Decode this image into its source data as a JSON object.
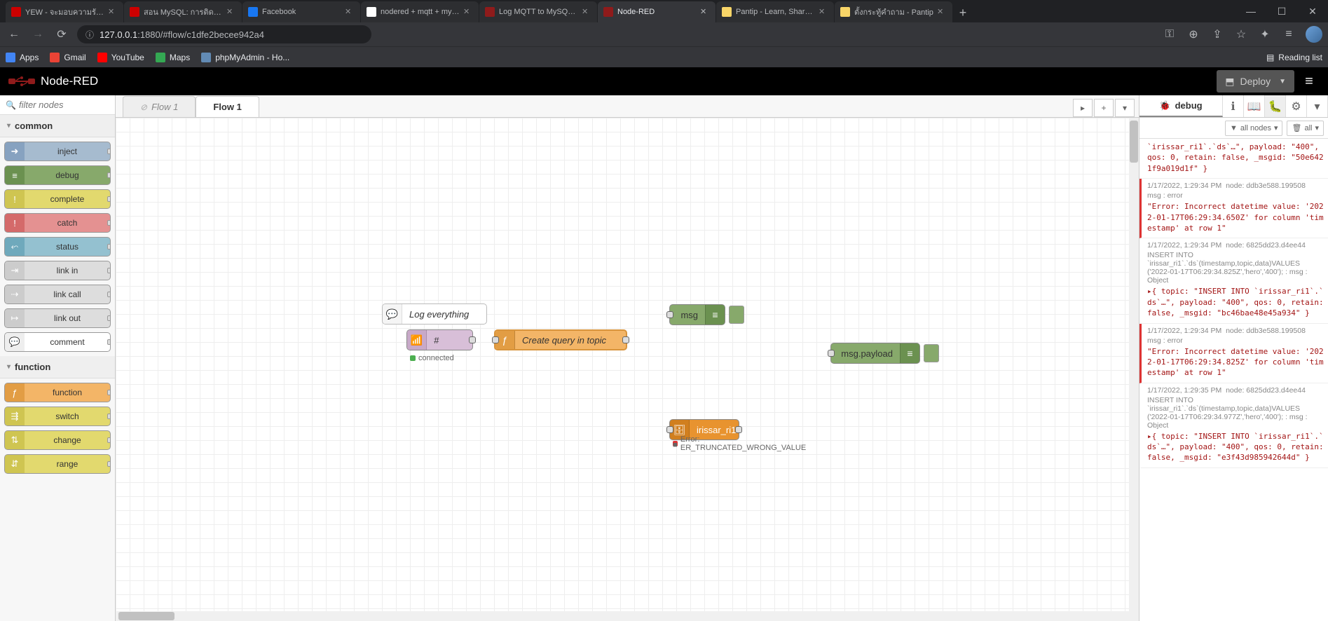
{
  "browser": {
    "tabs": [
      {
        "title": "YEW - จะมอบความรัก | Wish",
        "favicon": "#cc0000"
      },
      {
        "title": "สอน MySQL: การติดตั้ง MySQ",
        "favicon": "#cc0000"
      },
      {
        "title": "Facebook",
        "favicon": "#1877f2"
      },
      {
        "title": "nodered + mqtt + mysql -",
        "favicon": "#ffffff"
      },
      {
        "title": "Log MQTT to MySQL (flow",
        "favicon": "#8f1b1b"
      },
      {
        "title": "Node-RED",
        "favicon": "#8f1b1b",
        "active": true
      },
      {
        "title": "Pantip - Learn, Share & Fu",
        "favicon": "#f8d568"
      },
      {
        "title": "ตั้งกระทู้คำถาม - Pantip",
        "favicon": "#f8d568"
      }
    ],
    "url_host": "127.0.0.1",
    "url_port_path": ":1880/#flow/c1dfe2becee942a4",
    "bookmarks": [
      {
        "label": "Apps",
        "color": "#4285f4"
      },
      {
        "label": "Gmail",
        "color": "#ea4335"
      },
      {
        "label": "YouTube",
        "color": "#ff0000"
      },
      {
        "label": "Maps",
        "color": "#34a853"
      },
      {
        "label": "phpMyAdmin - Ho...",
        "color": "#628bb5"
      }
    ],
    "reading_list": "Reading list"
  },
  "nodered": {
    "brand": "Node-RED",
    "deploy": "Deploy",
    "palette_filter_placeholder": "filter nodes",
    "categories": [
      {
        "name": "common",
        "nodes": [
          {
            "label": "inject",
            "bg": "#a6bbcf",
            "icon_bg": "#87a2c0",
            "icon": "➜"
          },
          {
            "label": "debug",
            "bg": "#87a96b",
            "icon_bg": "#6b9150",
            "icon": "≡"
          },
          {
            "label": "complete",
            "bg": "#e2d96e",
            "icon_bg": "#cfc551",
            "icon": "!"
          },
          {
            "label": "catch",
            "bg": "#e49191",
            "icon_bg": "#d46a6a",
            "icon": "!"
          },
          {
            "label": "status",
            "bg": "#94c1d0",
            "icon_bg": "#6fa9bc",
            "icon": "⬿"
          },
          {
            "label": "link in",
            "bg": "#ddd",
            "icon_bg": "#ccc",
            "icon": "⇥"
          },
          {
            "label": "link call",
            "bg": "#ddd",
            "icon_bg": "#ccc",
            "icon": "⇢"
          },
          {
            "label": "link out",
            "bg": "#ddd",
            "icon_bg": "#ccc",
            "icon": "↦"
          },
          {
            "label": "comment",
            "bg": "#fff",
            "icon_bg": "#eee",
            "icon": "💬"
          }
        ]
      },
      {
        "name": "function",
        "nodes": [
          {
            "label": "function",
            "bg": "#f3b567",
            "icon_bg": "#e29d44",
            "icon": "ƒ"
          },
          {
            "label": "switch",
            "bg": "#e2d96e",
            "icon_bg": "#cfc551",
            "icon": "⇶"
          },
          {
            "label": "change",
            "bg": "#e2d96e",
            "icon_bg": "#cfc551",
            "icon": "⇅"
          },
          {
            "label": "range",
            "bg": "#e2d96e",
            "icon_bg": "#cfc551",
            "icon": "⇵"
          }
        ]
      }
    ],
    "workspace_tabs": [
      {
        "label": "Flow 1",
        "disabled": true
      },
      {
        "label": "Flow 1",
        "active": true
      }
    ],
    "flow_nodes": {
      "comment": {
        "label": "Log everything"
      },
      "mqtt": {
        "label": "#",
        "status": "connected"
      },
      "func": {
        "label": "Create query in topic"
      },
      "debug1": {
        "label": "msg"
      },
      "debug2": {
        "label": "msg.payload"
      },
      "mysql": {
        "label": "irissar_ri1",
        "error": "Error: ER_TRUNCATED_WRONG_VALUE"
      }
    },
    "sidebar": {
      "tab_label": "debug",
      "filter_all_nodes": "all nodes",
      "filter_all": "all"
    },
    "debug": [
      {
        "type": "obj",
        "text": "`irissar_ri1`.`ds`…\", payload: \"400\", qos: 0, retain: false, _msgid: \"50e6421f9a019d1f\" }"
      },
      {
        "type": "err",
        "ts": "1/17/2022, 1:29:34 PM",
        "node": "node: ddb3e588.199508",
        "topic": "msg : error",
        "text": "\"Error: Incorrect datetime value: '2022-01-17T06:29:34.650Z' for column 'timestamp' at row 1\""
      },
      {
        "type": "info",
        "ts": "1/17/2022, 1:29:34 PM",
        "node": "node: 6825dd23.d4ee44",
        "topic": "INSERT INTO `irissar_ri1`.`ds`(timestamp,topic,data)VALUES ('2022-01-17T06:29:34.825Z','hero','400'); : msg : Object",
        "text": "▸{ topic: \"INSERT INTO `irissar_ri1`.`ds`…\", payload: \"400\", qos: 0, retain: false, _msgid: \"bc46bae48e45a934\" }"
      },
      {
        "type": "err",
        "ts": "1/17/2022, 1:29:34 PM",
        "node": "node: ddb3e588.199508",
        "topic": "msg : error",
        "text": "\"Error: Incorrect datetime value: '2022-01-17T06:29:34.825Z' for column 'timestamp' at row 1\""
      },
      {
        "type": "info",
        "ts": "1/17/2022, 1:29:35 PM",
        "node": "node: 6825dd23.d4ee44",
        "topic": "INSERT INTO `irissar_ri1`.`ds`(timestamp,topic,data)VALUES ('2022-01-17T06:29:34.977Z','hero','400'); : msg : Object",
        "text": "▸{ topic: \"INSERT INTO `irissar_ri1`.`ds`…\", payload: \"400\", qos: 0, retain: false, _msgid: \"e3f43d985942644d\" }"
      }
    ]
  }
}
